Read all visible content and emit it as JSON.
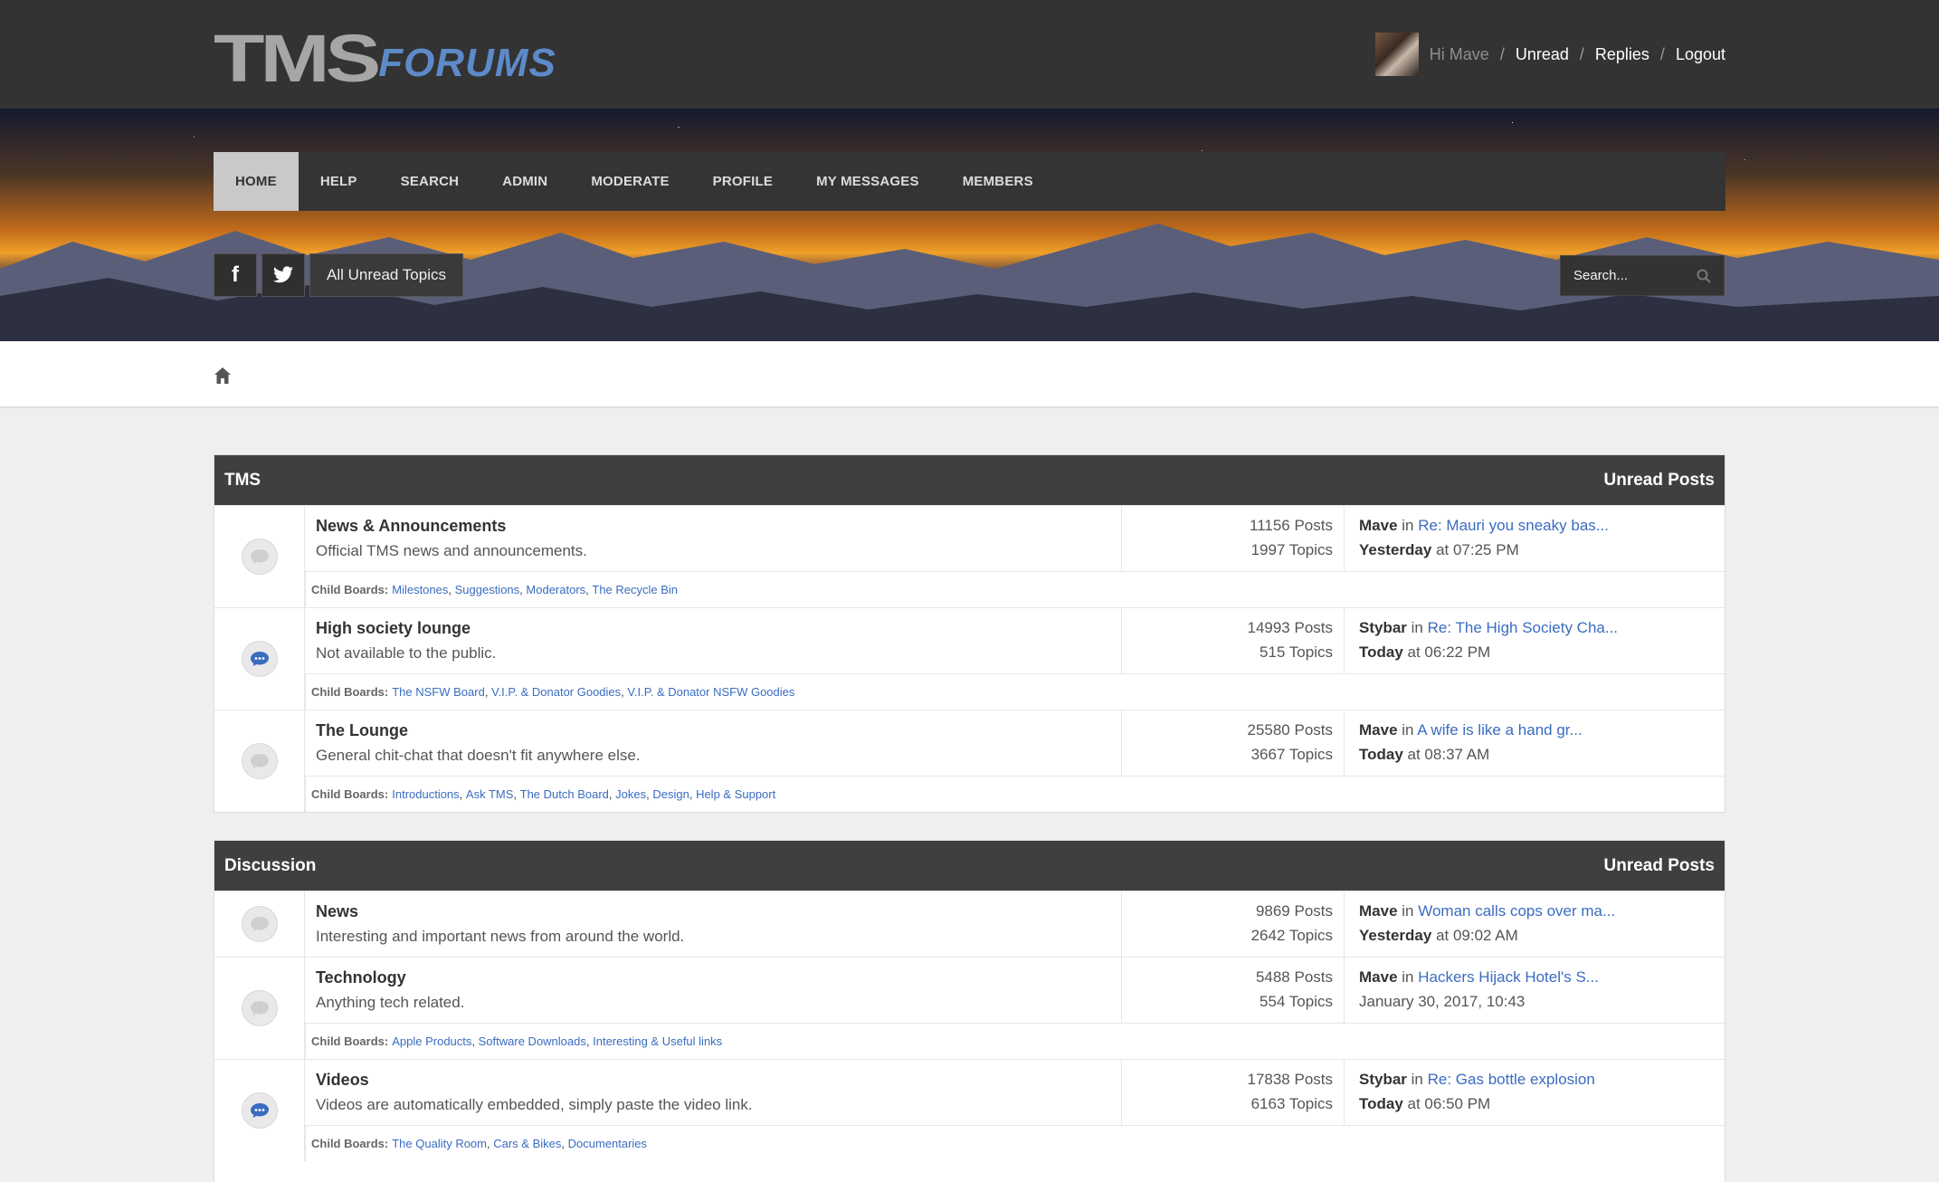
{
  "header": {
    "logo_tms": "TMS",
    "logo_forums": "FORUMS",
    "greeting": "Hi Mave",
    "links": [
      "Unread",
      "Replies",
      "Logout"
    ],
    "separator": "/"
  },
  "nav": {
    "items": [
      "HOME",
      "HELP",
      "SEARCH",
      "ADMIN",
      "MODERATE",
      "PROFILE",
      "MY MESSAGES",
      "MEMBERS"
    ],
    "active": "HOME"
  },
  "banner": {
    "facebook_glyph": "f",
    "unread_button": "All Unread Topics",
    "search_placeholder": "Search..."
  },
  "categories": [
    {
      "name": "TMS",
      "right_label": "Unread Posts",
      "boards": [
        {
          "title": "News & Announcements",
          "desc": "Official TMS news and announcements.",
          "posts": "11156 Posts",
          "topics": "1997 Topics",
          "last_user": "Mave",
          "in": "in",
          "last_topic": "Re: Mauri you sneaky bas...",
          "last_day": "Yesterday",
          "last_time": " at 07:25 PM",
          "child_label": "Child Boards:",
          "children": [
            "Milestones",
            "Suggestions",
            "Moderators",
            "The Recycle Bin"
          ],
          "new": false
        },
        {
          "title": "High society lounge",
          "desc": "Not available to the public.",
          "posts": "14993 Posts",
          "topics": "515 Topics",
          "last_user": "Stybar",
          "in": "in",
          "last_topic": "Re: The High Society Cha...",
          "last_day": "Today",
          "last_time": " at 06:22 PM",
          "child_label": "Child Boards:",
          "children": [
            "The NSFW Board",
            "V.I.P. & Donator Goodies",
            "V.I.P. & Donator NSFW Goodies"
          ],
          "new": true
        },
        {
          "title": "The Lounge",
          "desc": "General chit-chat that doesn't fit anywhere else.",
          "posts": "25580 Posts",
          "topics": "3667 Topics",
          "last_user": "Mave",
          "in": "in",
          "last_topic": "A wife is like a hand gr...",
          "last_day": "Today",
          "last_time": " at 08:37 AM",
          "child_label": "Child Boards:",
          "children": [
            "Introductions",
            "Ask TMS",
            "The Dutch Board",
            "Jokes",
            "Design",
            "Help & Support"
          ],
          "new": false
        }
      ]
    },
    {
      "name": "Discussion",
      "right_label": "Unread Posts",
      "boards": [
        {
          "title": "News",
          "desc": "Interesting and important news from around the world.",
          "posts": "9869 Posts",
          "topics": "2642 Topics",
          "last_user": "Mave",
          "in": "in",
          "last_topic": "Woman calls cops over ma...",
          "last_day": "Yesterday",
          "last_time": " at 09:02 AM",
          "new": false
        },
        {
          "title": "Technology",
          "desc": "Anything tech related.",
          "posts": "5488 Posts",
          "topics": "554 Topics",
          "last_user": "Mave",
          "in": "in",
          "last_topic": "Hackers Hijack Hotel's S...",
          "last_day": "",
          "last_time": "January 30, 2017, 10:43",
          "child_label": "Child Boards:",
          "children": [
            "Apple Products",
            "Software Downloads",
            "Interesting & Useful links"
          ],
          "new": false
        },
        {
          "title": "Videos",
          "desc": "Videos are automatically embedded, simply paste the video link.",
          "posts": "17838 Posts",
          "topics": "6163 Topics",
          "last_user": "Stybar",
          "in": "in",
          "last_topic": "Re: Gas bottle explosion",
          "last_day": "Today",
          "last_time": " at 06:50 PM",
          "child_label": "Child Boards:",
          "children": [
            "The Quality Room",
            "Cars & Bikes",
            "Documentaries"
          ],
          "new": true
        }
      ]
    }
  ],
  "colors": {
    "topbar": "#333333",
    "category_header": "#3f3f3f",
    "link": "#3a6cc0"
  }
}
